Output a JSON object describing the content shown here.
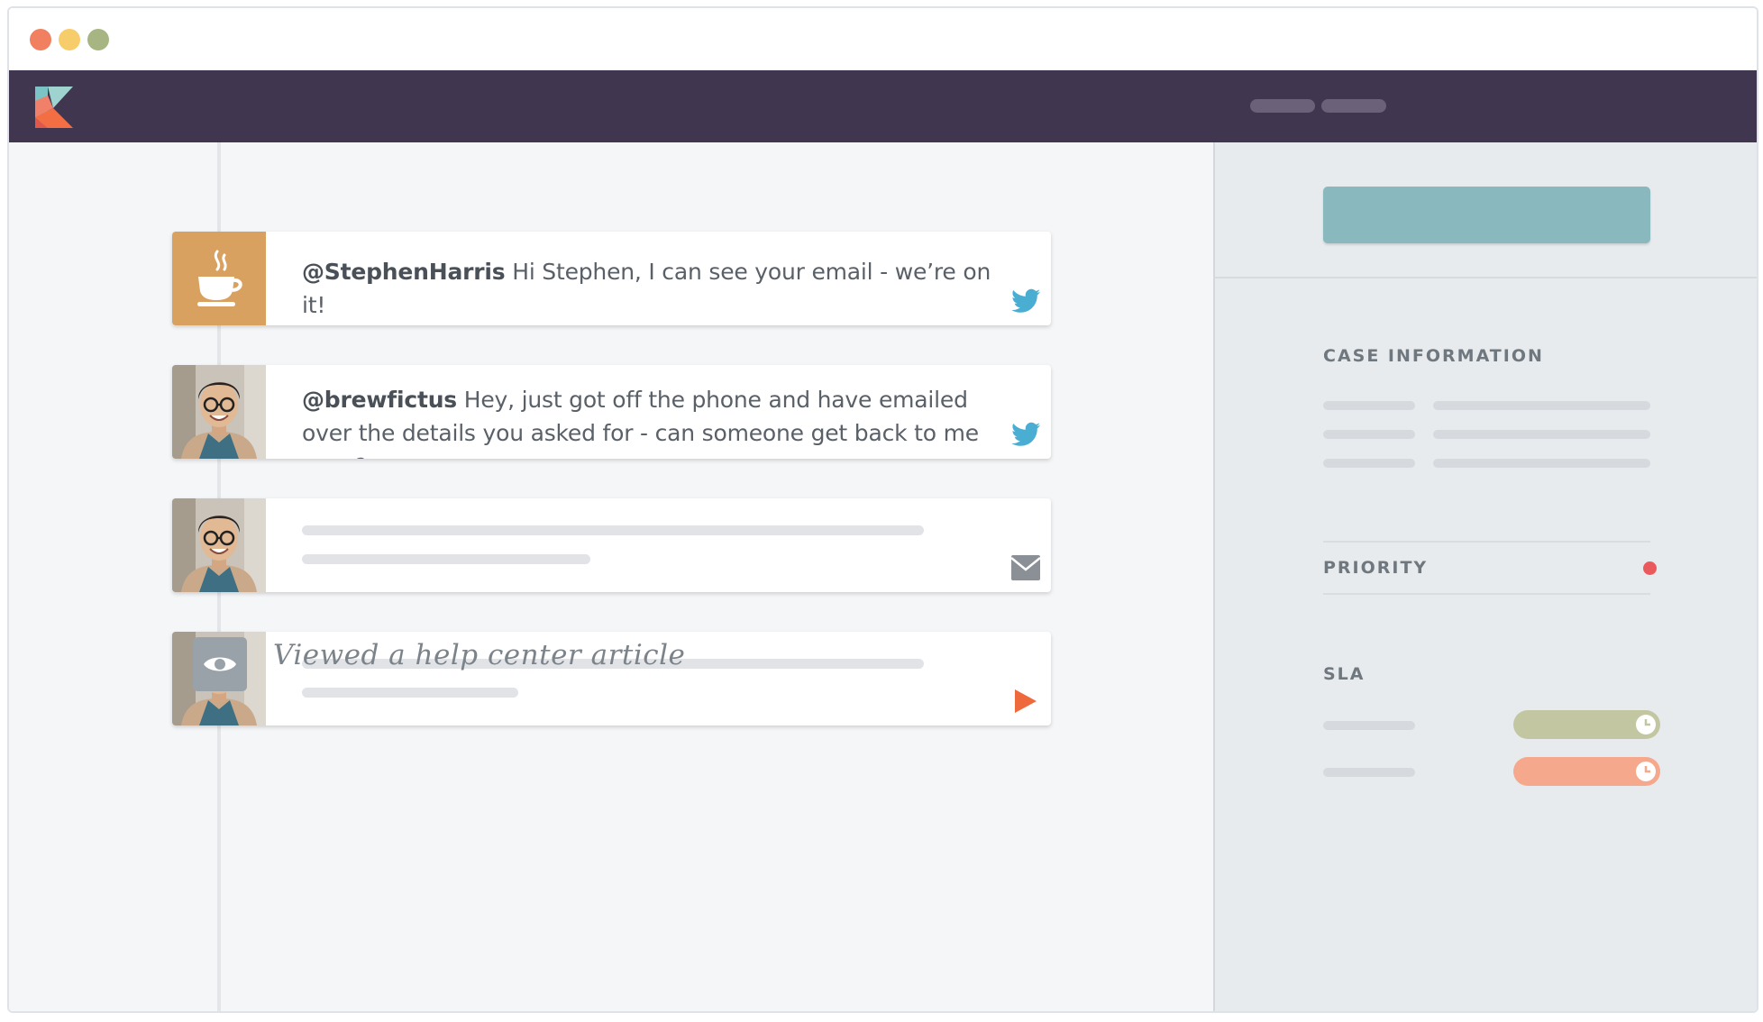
{
  "window": {
    "controls": [
      "close",
      "minimize",
      "maximize"
    ],
    "control_colors": {
      "close": "#f0805f",
      "minimize": "#f7cd6b",
      "maximize": "#a7b582"
    }
  },
  "topnav": {
    "logo": "kayako-k-logo",
    "background": "#413650",
    "nav_items": [
      "nav-placeholder-1",
      "nav-placeholder-2"
    ]
  },
  "timeline": {
    "items": [
      {
        "type": "reply",
        "avatar": "coffee-cup-icon",
        "avatar_color": "#d9a15f",
        "handle": "@StephenHarris",
        "text": " Hi Stephen, I can see your email - we’re on it!",
        "channel_icon": "twitter-icon"
      },
      {
        "type": "message",
        "avatar": "customer-photo",
        "handle": "@brewfictus",
        "text": " Hey, just got off the phone and have emailed over the details you asked for - can someone get back to me asap?",
        "channel_icon": "twitter-icon"
      },
      {
        "type": "message-placeholder",
        "avatar": "customer-photo",
        "channel_icon": "mail-icon"
      },
      {
        "type": "message-placeholder",
        "avatar": "customer-photo",
        "channel_icon": "play-icon"
      }
    ],
    "activity": {
      "icon": "eye-icon",
      "text": "Viewed a help center article"
    }
  },
  "sidebar": {
    "case_information_title": "CASE INFORMATION",
    "priority_label": "PRIORITY",
    "priority_color": "#ea5a5d",
    "sla_title": "SLA",
    "sla_items": [
      {
        "color": "#c3c7a1",
        "icon": "clock-icon"
      },
      {
        "color": "#f5a88c",
        "icon": "clock-icon"
      }
    ],
    "primary_button_color": "#8ab8bf",
    "twitter_color": "#4aaed3",
    "play_color": "#ee6a3c"
  }
}
